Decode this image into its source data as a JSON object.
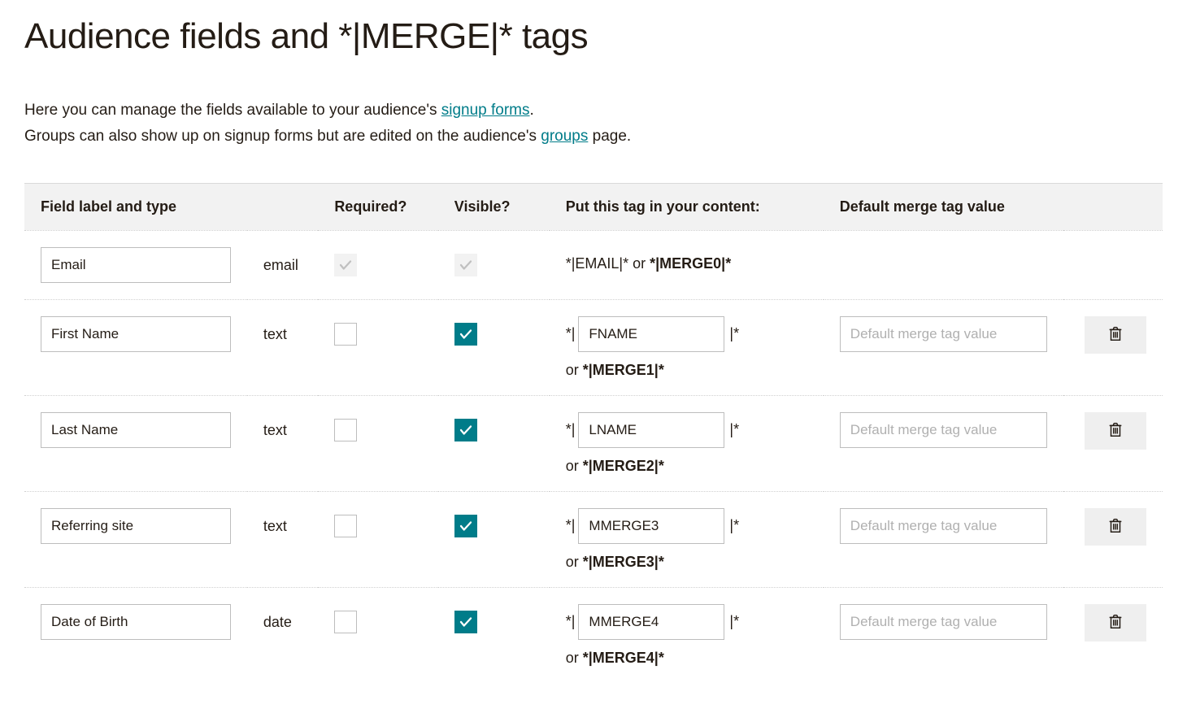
{
  "title": "Audience fields and *|MERGE|* tags",
  "intro": {
    "line1_before": "Here you can manage the fields available to your audience's ",
    "signup_link": "signup forms",
    "line1_after": ".",
    "line2_before": "Groups can also show up on signup forms but are edited on the audience's ",
    "groups_link": "groups",
    "line2_after": " page."
  },
  "columns": {
    "label": "Field label and type",
    "required": "Required?",
    "visible": "Visible?",
    "tag": "Put this tag in your content:",
    "default": "Default merge tag value"
  },
  "default_placeholder": "Default merge tag value",
  "text": {
    "or": "or ",
    "star_open": "*|",
    "star_close": "|*"
  },
  "rows": [
    {
      "label": "Email",
      "type": "email",
      "required_checked": true,
      "required_disabled": true,
      "visible_checked": true,
      "visible_disabled": true,
      "tag_primary": "*|EMAIL|*",
      "tag_alt": "*|MERGE0|*",
      "editable_tag": false,
      "deletable": false
    },
    {
      "label": "First Name",
      "type": "text",
      "required_checked": false,
      "required_disabled": false,
      "visible_checked": true,
      "visible_disabled": false,
      "tag_input": "FNAME",
      "tag_alt": "*|MERGE1|*",
      "editable_tag": true,
      "deletable": true
    },
    {
      "label": "Last Name",
      "type": "text",
      "required_checked": false,
      "required_disabled": false,
      "visible_checked": true,
      "visible_disabled": false,
      "tag_input": "LNAME",
      "tag_alt": "*|MERGE2|*",
      "editable_tag": true,
      "deletable": true
    },
    {
      "label": "Referring site",
      "type": "text",
      "required_checked": false,
      "required_disabled": false,
      "visible_checked": true,
      "visible_disabled": false,
      "tag_input": "MMERGE3",
      "tag_alt": "*|MERGE3|*",
      "editable_tag": true,
      "deletable": true
    },
    {
      "label": "Date of Birth",
      "type": "date",
      "required_checked": false,
      "required_disabled": false,
      "visible_checked": true,
      "visible_disabled": false,
      "tag_input": "MMERGE4",
      "tag_alt": "*|MERGE4|*",
      "editable_tag": true,
      "deletable": true
    }
  ]
}
